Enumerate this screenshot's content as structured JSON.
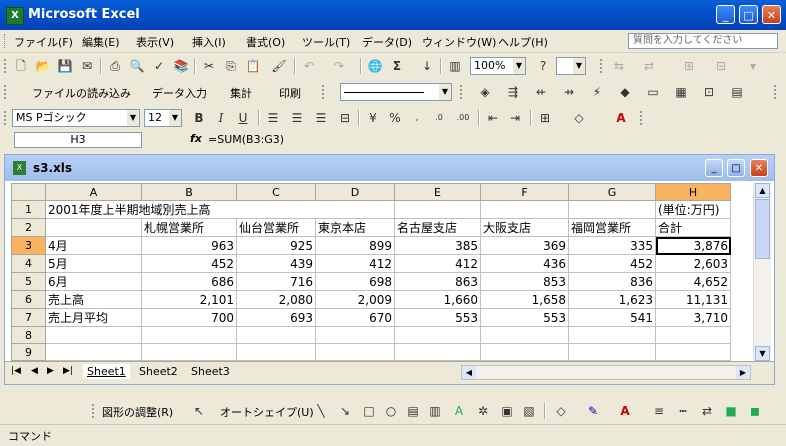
{
  "app": {
    "title": "Microsoft Excel"
  },
  "menu": {
    "items": [
      "ファイル(F)",
      "編集(E)",
      "表示(V)",
      "挿入(I)",
      "書式(O)",
      "ツール(T)",
      "データ(D)",
      "ウィンドウ(W)",
      "ヘルプ(H)"
    ],
    "help_placeholder": "質問を入力してください"
  },
  "toolbar": {
    "zoom": "100%"
  },
  "toolbar2": {
    "buttons": [
      "ファイルの読み込み",
      "データ入力",
      "集計",
      "印刷"
    ]
  },
  "format": {
    "font": "MS Pゴシック",
    "size": "12"
  },
  "formula": {
    "cell": "H3",
    "fx": "fx",
    "content": "=SUM(B3:G3)"
  },
  "workbook": {
    "name": "s3.xls"
  },
  "sheet": {
    "columns": [
      "A",
      "B",
      "C",
      "D",
      "E",
      "F",
      "G",
      "H"
    ],
    "rows": [
      {
        "num": "1",
        "cells": [
          "2001年度上半期地域別売上高",
          "",
          "",
          "",
          "",
          "",
          "",
          "(単位:万円)"
        ]
      },
      {
        "num": "2",
        "cells": [
          "",
          "札幌営業所",
          "仙台営業所",
          "東京本店",
          "名古屋支店",
          "大阪支店",
          "福岡営業所",
          "合計"
        ]
      },
      {
        "num": "3",
        "cells": [
          "4月",
          "963",
          "925",
          "899",
          "385",
          "369",
          "335",
          "3,876"
        ]
      },
      {
        "num": "4",
        "cells": [
          "5月",
          "452",
          "439",
          "412",
          "412",
          "436",
          "452",
          "2,603"
        ]
      },
      {
        "num": "5",
        "cells": [
          "6月",
          "686",
          "716",
          "698",
          "863",
          "853",
          "836",
          "4,652"
        ]
      },
      {
        "num": "6",
        "cells": [
          "売上高",
          "2,101",
          "2,080",
          "2,009",
          "1,660",
          "1,658",
          "1,623",
          "11,131"
        ]
      },
      {
        "num": "7",
        "cells": [
          "売上月平均",
          "700",
          "693",
          "670",
          "553",
          "553",
          "541",
          "3,710"
        ]
      },
      {
        "num": "8",
        "cells": [
          "",
          "",
          "",
          "",
          "",
          "",
          "",
          ""
        ]
      },
      {
        "num": "9",
        "cells": [
          "",
          "",
          "",
          "",
          "",
          "",
          "",
          ""
        ]
      }
    ],
    "tabs": [
      "Sheet1",
      "Sheet2",
      "Sheet3"
    ]
  },
  "drawing": {
    "adjust": "図形の調整(R)",
    "autoshape": "オートシェイプ(U)"
  },
  "status": {
    "mode": "コマンド"
  }
}
